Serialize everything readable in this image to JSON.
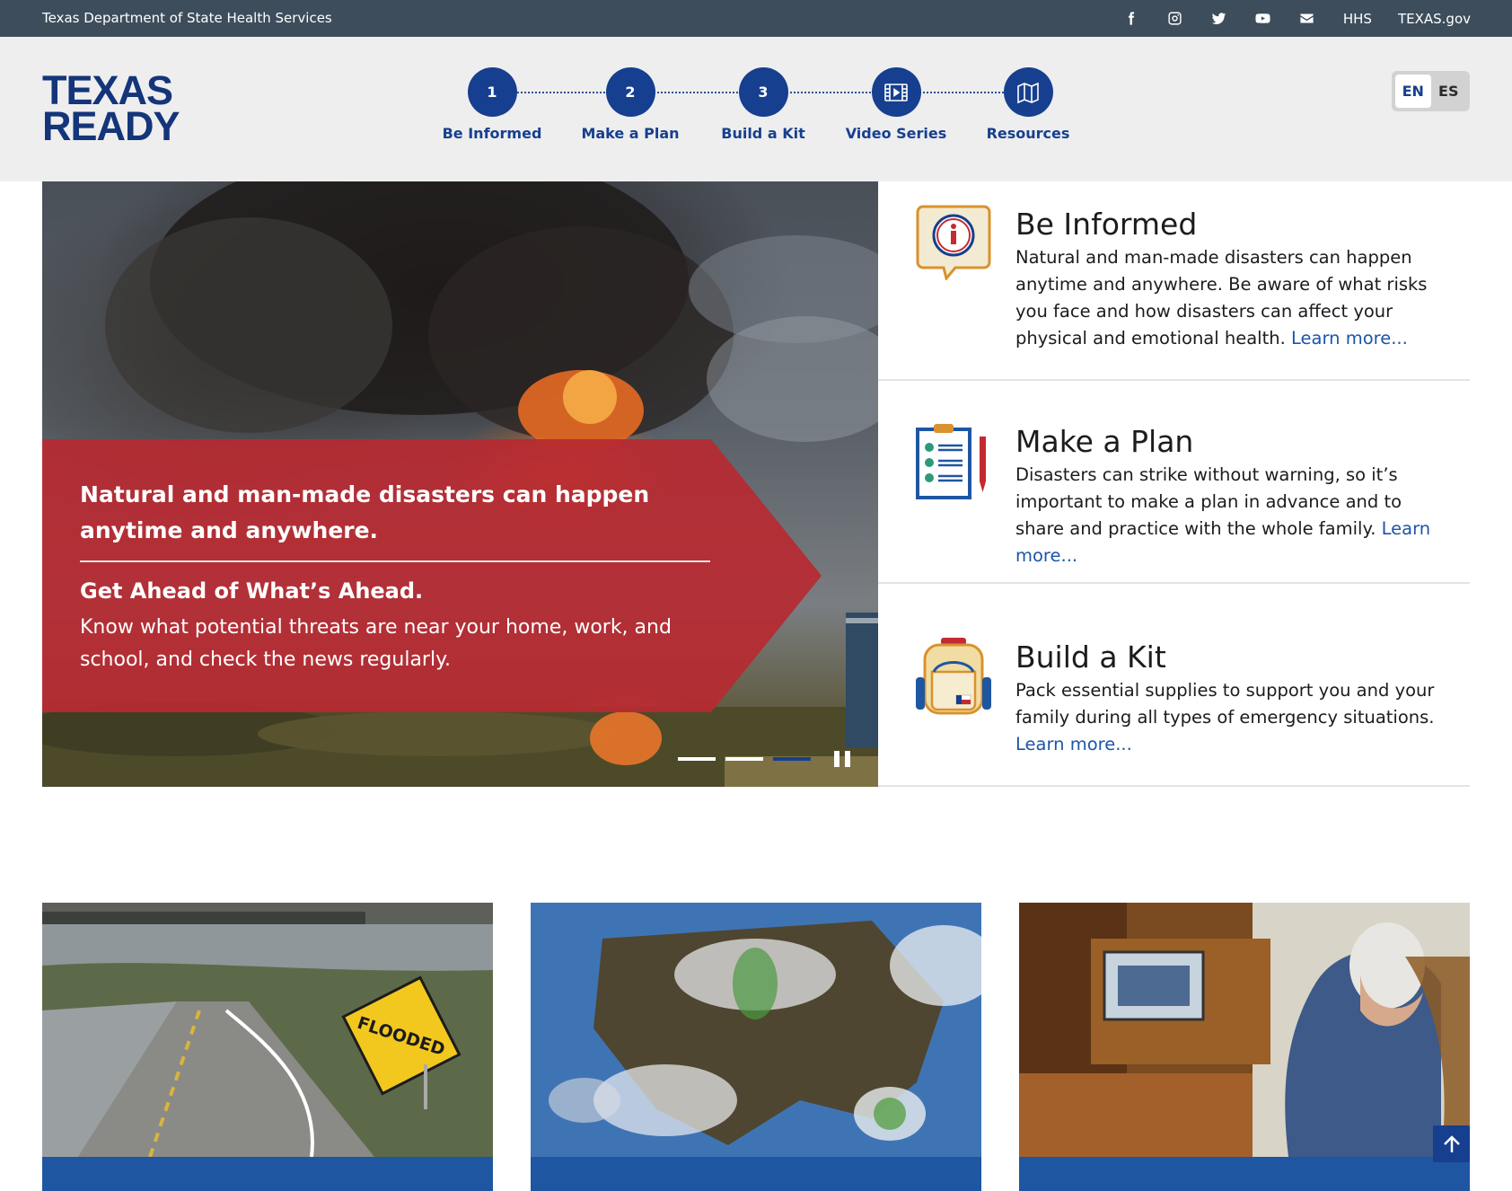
{
  "topbar": {
    "org": "Texas Department of State Health Services",
    "social_icons": [
      "facebook-icon",
      "instagram-icon",
      "twitter-icon",
      "youtube-icon",
      "email-icon"
    ],
    "links": [
      "HHS",
      "TEXAS.gov"
    ]
  },
  "header": {
    "logo_line1": "TEXAS",
    "logo_line2": "READY",
    "steps": [
      {
        "marker": "1",
        "label": "Be Informed"
      },
      {
        "marker": "2",
        "label": "Make a Plan"
      },
      {
        "marker": "3",
        "label": "Build a Kit"
      },
      {
        "marker": "video-icon",
        "label": "Video Series"
      },
      {
        "marker": "map-icon",
        "label": "Resources"
      }
    ],
    "languages": [
      "EN",
      "ES"
    ],
    "active_language": "EN"
  },
  "hero": {
    "headline": "Natural and man-made disasters can happen anytime and anywhere.",
    "subheading": "Get Ahead of What’s Ahead.",
    "text": "Know what potential threats are near your home, work, and school, and check the news regularly.",
    "slide_count": 3,
    "active_slide": 3
  },
  "features": [
    {
      "icon": "info-bubble-icon",
      "title": "Be Informed",
      "desc": "Natural and man-made disasters can happen anytime and anywhere. Be aware of what risks you face and how disasters can affect your physical and emotional health.",
      "link": "Learn more..."
    },
    {
      "icon": "clipboard-checklist-icon",
      "title": "Make a Plan",
      "desc": "Disasters can strike without warning, so it’s important to make a plan in advance and to share and practice with the whole family.",
      "link": "Learn more..."
    },
    {
      "icon": "backpack-icon",
      "title": "Build a Kit",
      "desc": "Pack essential supplies to support you and your family during all types of emergency situations.",
      "link": "Learn more..."
    }
  ],
  "cards": [
    {
      "image": "flooded-road-photo",
      "sign_text": "FLOODED"
    },
    {
      "image": "weather-satellite-map-photo"
    },
    {
      "image": "man-watching-tv-photo"
    }
  ],
  "colors": {
    "topbar": "#3e4d5c",
    "brand_blue": "#173f8f",
    "hero_banner_red": "#b72a31",
    "link_blue": "#1d55a8",
    "card_bar": "#1f56a2"
  }
}
